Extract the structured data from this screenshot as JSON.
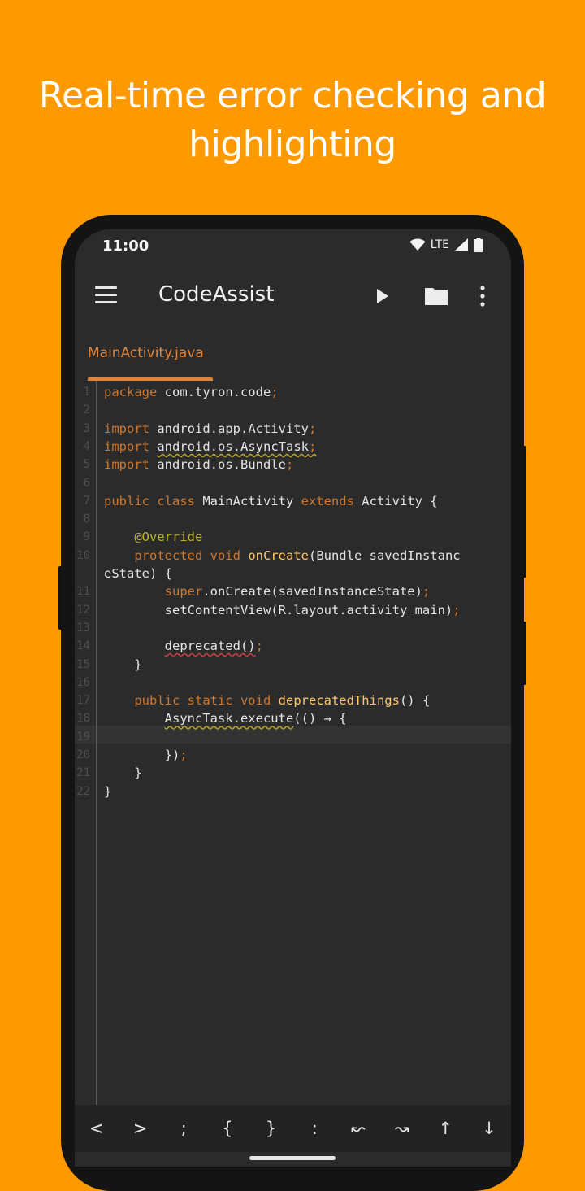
{
  "headline": {
    "line1": "Real-time error checking and",
    "line2": "highlighting"
  },
  "status": {
    "time": "11:00",
    "network": "LTE",
    "icons": [
      "wifi-icon",
      "signal-icon",
      "battery-icon"
    ]
  },
  "appbar": {
    "title": "CodeAssist",
    "icons": [
      "menu-icon",
      "run-icon",
      "folder-icon",
      "more-vert-icon"
    ]
  },
  "tab": {
    "label": "MainActivity.java"
  },
  "colors": {
    "background": "#FF9900",
    "editor_bg": "#2b2b2b",
    "keyword": "#cc7832",
    "function": "#ffc66d",
    "annotation": "#bbb529",
    "tab_active": "#e0843a"
  },
  "editor": {
    "current_line": 19,
    "lines": [
      {
        "n": "1",
        "segs": [
          [
            "kw",
            "package"
          ],
          [
            "pl",
            " com.tyron.code"
          ],
          [
            "kw",
            ";"
          ]
        ]
      },
      {
        "n": "2",
        "segs": []
      },
      {
        "n": "3",
        "segs": [
          [
            "kw",
            "import"
          ],
          [
            "pl",
            " android.app.Activity"
          ],
          [
            "kw",
            ";"
          ]
        ]
      },
      {
        "n": "4",
        "segs": [
          [
            "kw",
            "import"
          ],
          [
            "pl",
            " "
          ],
          [
            "pl-warn",
            "android.os.AsyncTask"
          ],
          [
            "kw-warn",
            ";"
          ]
        ]
      },
      {
        "n": "5",
        "segs": [
          [
            "kw",
            "import"
          ],
          [
            "pl",
            " android.os.Bundle"
          ],
          [
            "kw",
            ";"
          ]
        ]
      },
      {
        "n": "6",
        "segs": []
      },
      {
        "n": "7",
        "segs": [
          [
            "kw",
            "public class"
          ],
          [
            "pl",
            " MainActivity "
          ],
          [
            "kw",
            "extends"
          ],
          [
            "pl",
            " Activity {"
          ]
        ]
      },
      {
        "n": "8",
        "segs": []
      },
      {
        "n": "9",
        "segs": [
          [
            "pl",
            "    "
          ],
          [
            "an",
            "@Override"
          ]
        ]
      },
      {
        "n": "10",
        "segs": [
          [
            "pl",
            "    "
          ],
          [
            "kw",
            "protected void"
          ],
          [
            "pl",
            " "
          ],
          [
            "fn",
            "onCreate"
          ],
          [
            "pl",
            "(Bundle savedInstanc"
          ]
        ]
      },
      {
        "n": "",
        "segs": [
          [
            "pl",
            "eState) {"
          ]
        ]
      },
      {
        "n": "11",
        "segs": [
          [
            "pl",
            "        "
          ],
          [
            "kw",
            "super"
          ],
          [
            "pl",
            ".onCreate(savedInstanceState)"
          ],
          [
            "kw",
            ";"
          ]
        ]
      },
      {
        "n": "12",
        "segs": [
          [
            "pl",
            "        setContentView(R.layout.activity_main)"
          ],
          [
            "kw",
            ";"
          ]
        ]
      },
      {
        "n": "13",
        "segs": []
      },
      {
        "n": "14",
        "segs": [
          [
            "pl",
            "        "
          ],
          [
            "pl-err",
            "deprecated()"
          ],
          [
            "kw",
            ";"
          ]
        ]
      },
      {
        "n": "15",
        "segs": [
          [
            "pl",
            "    }"
          ]
        ]
      },
      {
        "n": "16",
        "segs": []
      },
      {
        "n": "17",
        "segs": [
          [
            "pl",
            "    "
          ],
          [
            "kw",
            "public static void"
          ],
          [
            "pl",
            " "
          ],
          [
            "fn",
            "deprecatedThings"
          ],
          [
            "pl",
            "() {"
          ]
        ]
      },
      {
        "n": "18",
        "segs": [
          [
            "pl",
            "        "
          ],
          [
            "pl-warn",
            "AsyncTask.execute"
          ],
          [
            "pl",
            "(() → {"
          ]
        ]
      },
      {
        "n": "19",
        "segs": []
      },
      {
        "n": "20",
        "segs": [
          [
            "pl",
            "        })"
          ],
          [
            "kw",
            ";"
          ]
        ]
      },
      {
        "n": "21",
        "segs": [
          [
            "pl",
            "    }"
          ]
        ]
      },
      {
        "n": "22",
        "segs": [
          [
            "pl",
            "}"
          ]
        ]
      }
    ]
  },
  "symbols": [
    "<",
    ">",
    ";",
    "{",
    "}",
    ":",
    "↜",
    "↝",
    "↑",
    "↓"
  ]
}
